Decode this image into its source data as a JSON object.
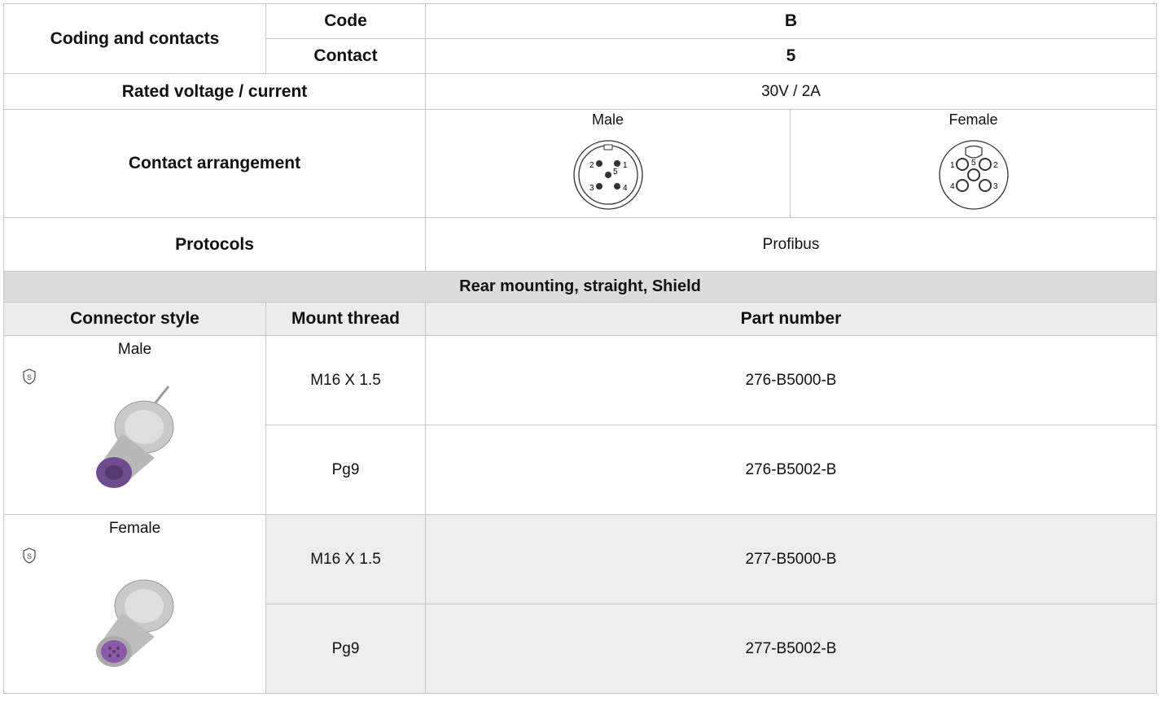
{
  "coding": {
    "label": "Coding and contacts",
    "code_label": "Code",
    "code_value": "B",
    "contact_label": "Contact",
    "contact_value": "5"
  },
  "rated": {
    "label": "Rated voltage / current",
    "value": "30V / 2A"
  },
  "arrangement": {
    "label": "Contact arrangement",
    "male_label": "Male",
    "female_label": "Female",
    "male_pins": [
      "1",
      "2",
      "3",
      "4",
      "5"
    ],
    "female_pins": [
      "1",
      "2",
      "3",
      "4",
      "5"
    ]
  },
  "protocols": {
    "label": "Protocols",
    "value": "Profibus"
  },
  "section_title": "Rear mounting, straight, Shield",
  "columns": {
    "style": "Connector style",
    "thread": "Mount thread",
    "part": "Part number"
  },
  "rows": [
    {
      "style": "Male",
      "icon": "shield-icon",
      "image_color": "#6e4d8e",
      "variants": [
        {
          "thread": "M16 X 1.5",
          "part": "276-B5000-B"
        },
        {
          "thread": "Pg9",
          "part": "276-B5002-B"
        }
      ]
    },
    {
      "style": "Female",
      "icon": "shield-icon",
      "image_color": "#8a5aa8",
      "variants": [
        {
          "thread": "M16 X 1.5",
          "part": "277-B5000-B"
        },
        {
          "thread": "Pg9",
          "part": "277-B5002-B"
        }
      ]
    }
  ]
}
